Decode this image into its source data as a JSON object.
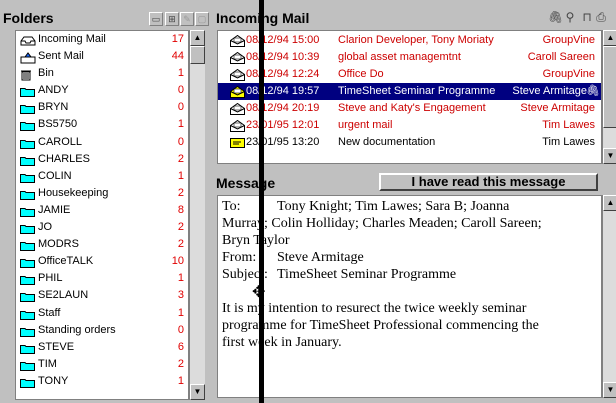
{
  "folders_pane": {
    "title": "Folders",
    "folders": [
      {
        "name": "Incoming Mail",
        "count": "17",
        "icon": "inbox-icon"
      },
      {
        "name": "Sent Mail",
        "count": "44",
        "icon": "sent-icon"
      },
      {
        "name": "Bin",
        "count": "1",
        "icon": "bin-icon"
      },
      {
        "name": "ANDY",
        "count": "0",
        "icon": "folder-icon"
      },
      {
        "name": "BRYN",
        "count": "0",
        "icon": "folder-icon"
      },
      {
        "name": "BS5750",
        "count": "1",
        "icon": "folder-icon"
      },
      {
        "name": "CAROLL",
        "count": "0",
        "icon": "folder-icon"
      },
      {
        "name": "CHARLES",
        "count": "2",
        "icon": "folder-icon"
      },
      {
        "name": "COLIN",
        "count": "1",
        "icon": "folder-icon"
      },
      {
        "name": "Housekeeping",
        "count": "2",
        "icon": "folder-icon"
      },
      {
        "name": "JAMIE",
        "count": "8",
        "icon": "folder-icon"
      },
      {
        "name": "JO",
        "count": "2",
        "icon": "folder-icon"
      },
      {
        "name": "MODRS",
        "count": "2",
        "icon": "folder-icon"
      },
      {
        "name": "OfficeTALK",
        "count": "10",
        "icon": "folder-icon"
      },
      {
        "name": "PHIL",
        "count": "1",
        "icon": "folder-icon"
      },
      {
        "name": "SE2LAUN",
        "count": "3",
        "icon": "folder-icon"
      },
      {
        "name": "Staff",
        "count": "1",
        "icon": "folder-icon"
      },
      {
        "name": "Standing orders",
        "count": "0",
        "icon": "folder-icon"
      },
      {
        "name": "STEVE",
        "count": "6",
        "icon": "folder-icon"
      },
      {
        "name": "TIM",
        "count": "2",
        "icon": "folder-icon"
      },
      {
        "name": "TONY",
        "count": "1",
        "icon": "folder-icon"
      }
    ]
  },
  "mail_pane": {
    "title": "Incoming Mail",
    "messages": [
      {
        "date": "08/12/94 15:00",
        "subject": "Clarion Developer, Tony Moriaty",
        "from": "GroupVine",
        "state": "unread"
      },
      {
        "date": "08/12/94 10:39",
        "subject": "global asset managemtnt",
        "from": "Caroll Sareen",
        "state": "unread"
      },
      {
        "date": "08/12/94 12:24",
        "subject": "Office Do",
        "from": "GroupVine",
        "state": "unread"
      },
      {
        "date": "08/12/94 19:57",
        "subject": "TimeSheet Seminar Programme",
        "from": "Steve Armitage",
        "state": "selected",
        "attachment": true
      },
      {
        "date": "08/12/94 20:19",
        "subject": "Steve and Katy's Engagement",
        "from": "Steve Armitage",
        "state": "unread"
      },
      {
        "date": "23/01/95 12:01",
        "subject": "urgent mail",
        "from": "Tim Lawes",
        "state": "unread"
      },
      {
        "date": "23/01/95 13:20",
        "subject": "New documentation",
        "from": "Tim Lawes",
        "state": "read"
      }
    ]
  },
  "message_pane": {
    "title": "Message",
    "read_button": "I have read this message",
    "to_label": "To:",
    "to_line1": "Tony Knight; Tim Lawes; Sara B; Joanna",
    "to_line2": "Murray; Colin Holliday; Charles Meaden; Caroll Sareen;",
    "to_line3": "Bryn Taylor",
    "from_label": "From:",
    "from_value": "Steve Armitage",
    "subject_label": "Subject:",
    "subject_value": "TimeSheet Seminar Programme",
    "body_line1": "It is my intention to resurect the twice weekly seminar",
    "body_line2": "programme for TimeSheet Professional commencing the",
    "body_line3": "first week in January."
  }
}
